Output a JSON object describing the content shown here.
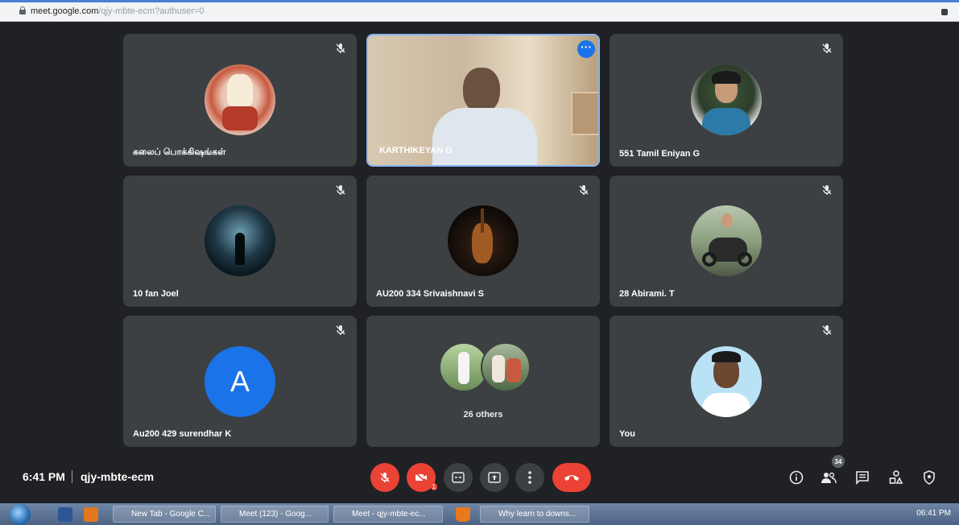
{
  "browser": {
    "url_host": "meet.google.com",
    "url_path": "/qjy-mbte-ecm?authuser=0"
  },
  "tiles": [
    {
      "name": "கலைப் பொக்கிஷங்கள்",
      "icon": "mic-off-icon"
    },
    {
      "name": "KARTHIKEYAN G",
      "icon": "more-options-icon"
    },
    {
      "name": "551 Tamil Eniyan G",
      "icon": "mic-off-icon"
    },
    {
      "name": "10 fan Joel",
      "icon": "mic-off-icon"
    },
    {
      "name": "AU200 334 Srivaishnavi S",
      "icon": "mic-off-icon"
    },
    {
      "name": "28 Abirami. T",
      "icon": "mic-off-icon"
    },
    {
      "name": "Au200 429 surendhar K",
      "initial": "A",
      "icon": "mic-off-icon"
    },
    {
      "others_label": "26 others"
    },
    {
      "name": "You",
      "icon": "mic-off-icon"
    }
  ],
  "controls": {
    "time": "6:41 PM",
    "separator": "|",
    "meeting_code": "qjy-mbte-ecm",
    "camera_badge": "1",
    "participants_count": "34",
    "colors": {
      "red": "#ea4335",
      "button": "#3c4043",
      "accent": "#8ab4f8",
      "avatar_a": "#1a73e8"
    }
  },
  "taskbar": {
    "items": [
      "New Tab - Google C...",
      "Meet (123) - Goog...",
      "Meet - qjy-mbte-ec...",
      "Why learn to downs..."
    ],
    "clock": "06:41 PM"
  }
}
